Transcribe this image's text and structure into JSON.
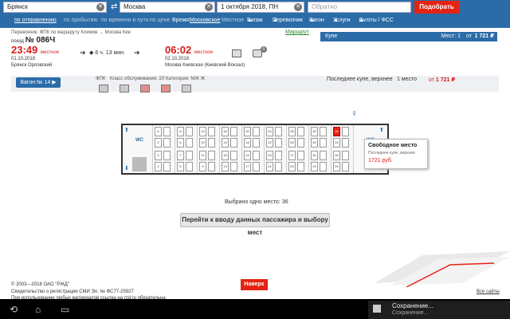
{
  "search": {
    "from": "Брянск",
    "to": "Москва",
    "date": "1 октября 2018, ПН",
    "return_placeholder": "Обратно",
    "find_label": "Подобрать"
  },
  "filters": {
    "sort_departure": "по отправлению",
    "sort_arrival": "по прибытию",
    "sort_duration": "по времени в пути",
    "sort_price": "по цене",
    "time_label": "Время:",
    "time_moscow": "Московское",
    "time_local": "Местное",
    "baggage": "Багаж",
    "carrier": "Перевозчик",
    "wagon": "Вагон",
    "services": "Услуги",
    "benefits": "Льготы / ФСС"
  },
  "train": {
    "carrier_line": "Перевозчик: ФПК   по маршруту Климов → Москва Кие",
    "route_link": "Маршрут",
    "train_prefix": "поезд",
    "number": "№ 086Ч",
    "dep_time": "23:49",
    "dep_zone": "местное",
    "dep_date": "01.10.2018",
    "dep_station": "Брянск Орловский",
    "duration": "6 ч. 13 мин.",
    "arr_time": "06:02",
    "arr_zone": "местное",
    "arr_date": "02.10.2018",
    "arr_station": "Москва Киевская (Киевский Вокзал)",
    "badge_count": "0"
  },
  "class_bar": {
    "name": "Купе",
    "seats": "Мест: 1",
    "from": "от",
    "price": "1 721 ₽"
  },
  "wagon": {
    "button": "Вагон № 14",
    "company": "ФПК",
    "service_class": "Класс обслуживания: 2Л",
    "category": "Категория: МЖ Ж",
    "summary_seat": "Последнее купе, верхнее",
    "summary_count": "1 место",
    "summary_from": "от",
    "summary_price": "1 721 ₽"
  },
  "seats_top": [
    "4",
    "8",
    "12",
    "16",
    "20",
    "24",
    "28",
    "32",
    "36"
  ],
  "seats_upper": [
    "2",
    "6",
    "10",
    "14",
    "18",
    "22",
    "26",
    "30",
    "34"
  ],
  "seats_lower": [
    "1",
    "5",
    "9",
    "13",
    "17",
    "21",
    "25",
    "29",
    "33"
  ],
  "seats_mid": [
    "3",
    "7",
    "11",
    "15",
    "19",
    "23",
    "27",
    "31",
    "35"
  ],
  "tooltip": {
    "title": "Свободное место",
    "desc": "Последнее купе, верхнее",
    "price": "1721 руб."
  },
  "selection": {
    "summary": "Выбрано одно место: 36",
    "proceed": "Перейти к вводу данных пассажира и выбору мест"
  },
  "footer": {
    "copyright": "© 2003—2018 ОАО \"РЖД\"",
    "license": "Свидетельство о регистрации СМИ Эл. № ФС77-25927",
    "notice": "При использовании любых материалов ссылка на rzd.ru обязательна",
    "up_button": "Наверх",
    "all_sites": "Все сайты"
  },
  "android": {
    "notif_title": "Сохранение...",
    "notif_sub": "Сохранение..."
  }
}
